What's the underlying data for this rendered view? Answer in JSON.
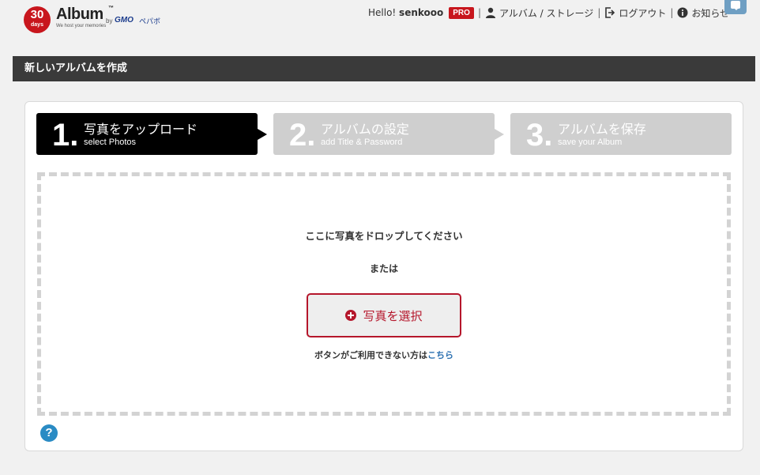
{
  "header": {
    "logo": {
      "number": "30",
      "days": "days",
      "name": "Album",
      "tm": "™",
      "by": "by",
      "gmo": "GMO",
      "pepabo": "ペパボ",
      "tagline": "We host your memories"
    },
    "greeting_prefix": "Hello! ",
    "username": "senkooo",
    "pro_badge": "PRO",
    "separator": "|",
    "nav": [
      {
        "label": "アルバム / ストレージ",
        "icon": "user-icon"
      },
      {
        "label": "ログアウト",
        "icon": "logout-icon"
      },
      {
        "label": "お知らせ",
        "icon": "info-icon"
      }
    ]
  },
  "page_title": "新しいアルバムを作成",
  "steps": [
    {
      "num": "1.",
      "label": "写真をアップロード",
      "sub": "select Photos",
      "active": true
    },
    {
      "num": "2.",
      "label": "アルバムの設定",
      "sub": "add Title & Password",
      "active": false
    },
    {
      "num": "3.",
      "label": "アルバムを保存",
      "sub": "save your Album",
      "active": false
    }
  ],
  "dropzone": {
    "drop_text": "ここに写真をドロップしてください",
    "or_text": "または",
    "select_button": "写真を選択",
    "fallback_text": "ボタンがご利用できない方は",
    "fallback_link": "こちら"
  },
  "help_icon": "?",
  "colors": {
    "brand_red": "#c8161d",
    "button_red": "#b5162b",
    "titlebar": "#3a3a3a",
    "step_active": "#000000",
    "step_inactive": "#cfcfcf",
    "link": "#2a6fb0",
    "help": "#2a8bc4"
  }
}
